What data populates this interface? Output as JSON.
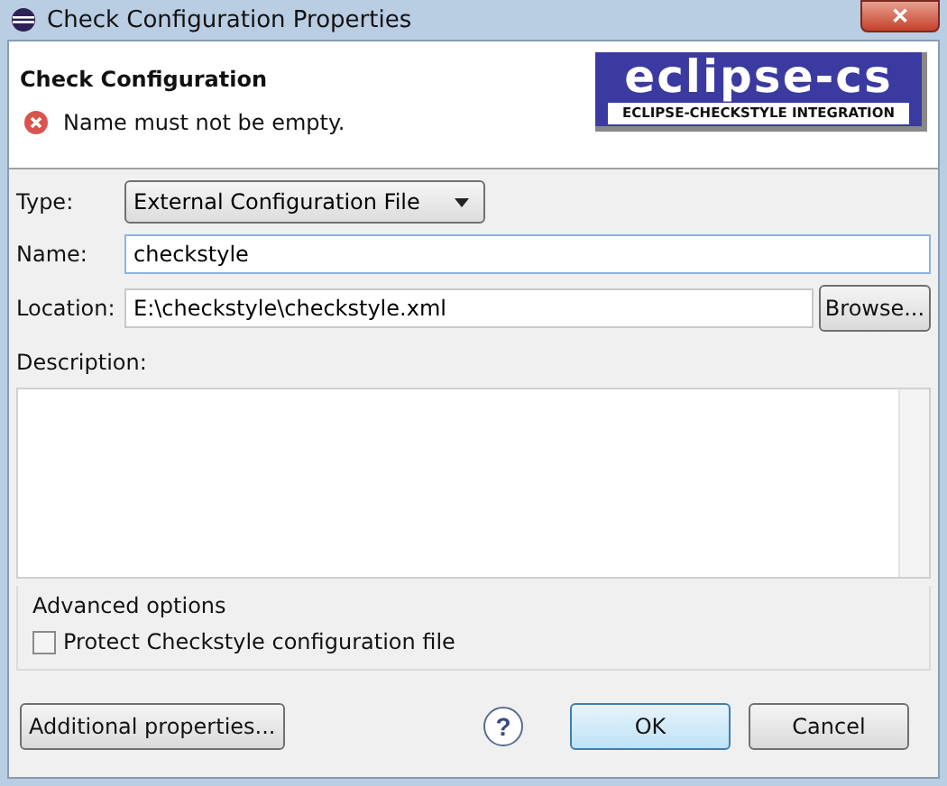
{
  "window": {
    "title": "Check Configuration Properties",
    "close": "✕"
  },
  "header": {
    "title": "Check Configuration",
    "error": "Name must not be empty.",
    "logo": {
      "main": "eclipse-cs",
      "sub": "ECLIPSE-CHECKSTYLE INTEGRATION"
    }
  },
  "form": {
    "type": {
      "label": "Type:",
      "value": "External Configuration File"
    },
    "name": {
      "label": "Name:",
      "value": "checkstyle"
    },
    "location": {
      "label": "Location:",
      "value": "E:\\checkstyle\\checkstyle.xml",
      "button": "Browse..."
    },
    "description": {
      "label": "Description:"
    }
  },
  "advanced": {
    "title": "Advanced options",
    "options": [
      {
        "label": "Protect Checkstyle configuration file",
        "checked": false
      }
    ]
  },
  "buttons": {
    "additional": "Additional properties...",
    "help": "?",
    "ok": "OK",
    "cancel": "Cancel"
  }
}
